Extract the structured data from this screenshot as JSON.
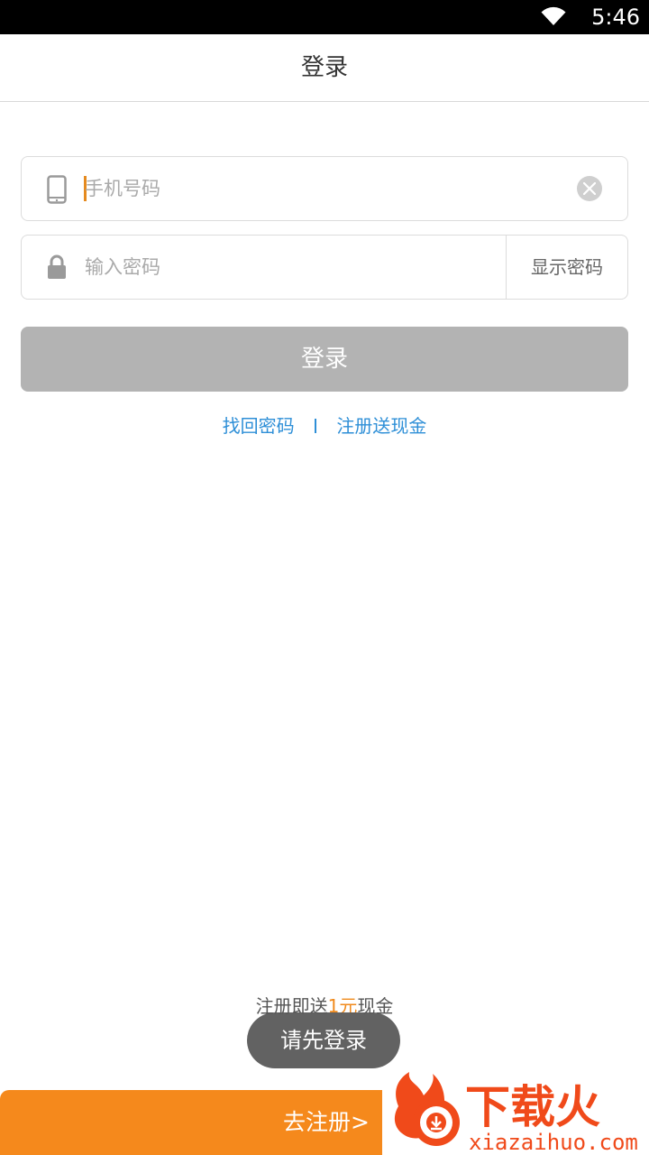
{
  "status_bar": {
    "time": "5:46"
  },
  "header": {
    "title": "登录"
  },
  "form": {
    "phone_placeholder": "手机号码",
    "password_placeholder": "输入密码",
    "show_password_label": "显示密码",
    "login_button": "登录"
  },
  "links": {
    "forgot_password": "找回密码",
    "register_cash": "注册送现金"
  },
  "promo": {
    "line1_prefix": "注册即送",
    "line1_amount": "1元",
    "line1_suffix": "现金"
  },
  "toast": {
    "text": "请先登录"
  },
  "register_bar": {
    "label": "去注册>"
  },
  "watermark": {
    "logo_text": "下载火",
    "site": "xiazaihuo.com"
  },
  "colors": {
    "accent": "#f5891c",
    "link": "#2e8fd7",
    "disabled_button": "#b3b3b3",
    "caret": "#e58a1f"
  },
  "icons": [
    "wifi-icon",
    "phone-icon",
    "lock-icon",
    "clear-icon",
    "watermark-logo-icon"
  ]
}
